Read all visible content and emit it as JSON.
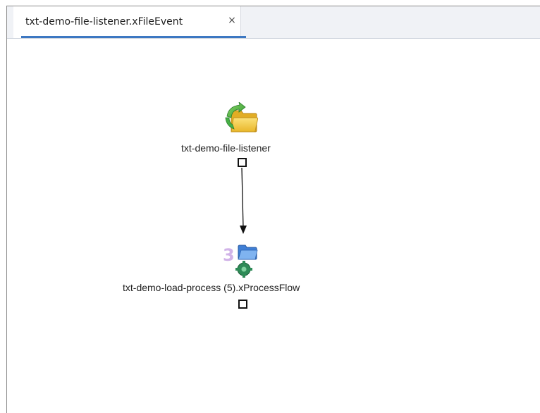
{
  "editor": {
    "tab": {
      "label": "txt-demo-file-listener.xFileEvent",
      "close_glyph": "×",
      "active": true,
      "accent_color": "#3d78c2"
    }
  },
  "diagram": {
    "nodes": [
      {
        "id": "file-listener",
        "label": "txt-demo-file-listener",
        "icon": "file-listener-folder-icon"
      },
      {
        "id": "process-flow",
        "label": "txt-demo-load-process (5).xProcessFlow",
        "icon": "process-flow-icon"
      }
    ],
    "edges": [
      {
        "from": "file-listener",
        "to": "process-flow"
      }
    ]
  },
  "colors": {
    "folder": "#f2c83a",
    "arrow_green": "#3aa83a",
    "process_blue": "#3f7fd6",
    "process_green": "#2e8b57",
    "process_purple": "#b58ad6"
  }
}
